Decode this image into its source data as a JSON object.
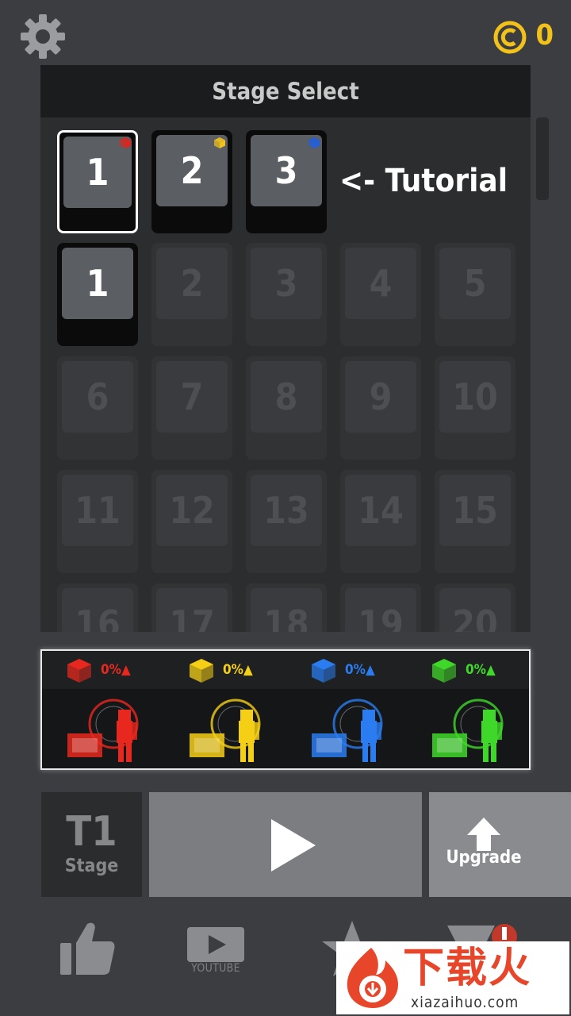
{
  "header": {
    "coin_count": "0"
  },
  "panel": {
    "title": "Stage Select",
    "tutorial_label": "<- Tutorial",
    "tutorial_stages": [
      {
        "label": "1",
        "cube_color": "#d9261f",
        "selected": true
      },
      {
        "label": "2",
        "cube_color": "#f2c21b",
        "selected": false
      },
      {
        "label": "3",
        "cube_color": "#1f5fe0",
        "selected": false
      }
    ],
    "stages": [
      "1",
      "2",
      "3",
      "4",
      "5",
      "6",
      "7",
      "8",
      "9",
      "10",
      "11",
      "12",
      "13",
      "14",
      "15",
      "16",
      "17",
      "18",
      "19",
      "20"
    ],
    "unlocked_stages": [
      "1"
    ]
  },
  "elements": [
    {
      "name": "red",
      "percent": "0%▲",
      "color": "#e8281f"
    },
    {
      "name": "yellow",
      "percent": "0%▲",
      "color": "#f5cf16"
    },
    {
      "name": "blue",
      "percent": "0%▲",
      "color": "#2a7cf0"
    },
    {
      "name": "green",
      "percent": "0%▲",
      "color": "#3fd82a"
    }
  ],
  "buttons": {
    "stage_code": "T1",
    "stage_label": "Stage",
    "upgrade_label": "Upgrade"
  },
  "nav": {
    "youtube_label": "YOUTUBE"
  },
  "watermark": {
    "title": "下载火",
    "url": "xiazaihuo.com"
  },
  "icons": {
    "settings": "gear-icon",
    "coin": "coin-icon",
    "play": "play-icon",
    "upgrade": "arrow-up-icon",
    "like": "thumbs-up-icon",
    "youtube": "youtube-icon",
    "rate": "star-icon",
    "remove_ads": "remove-ads-icon"
  }
}
